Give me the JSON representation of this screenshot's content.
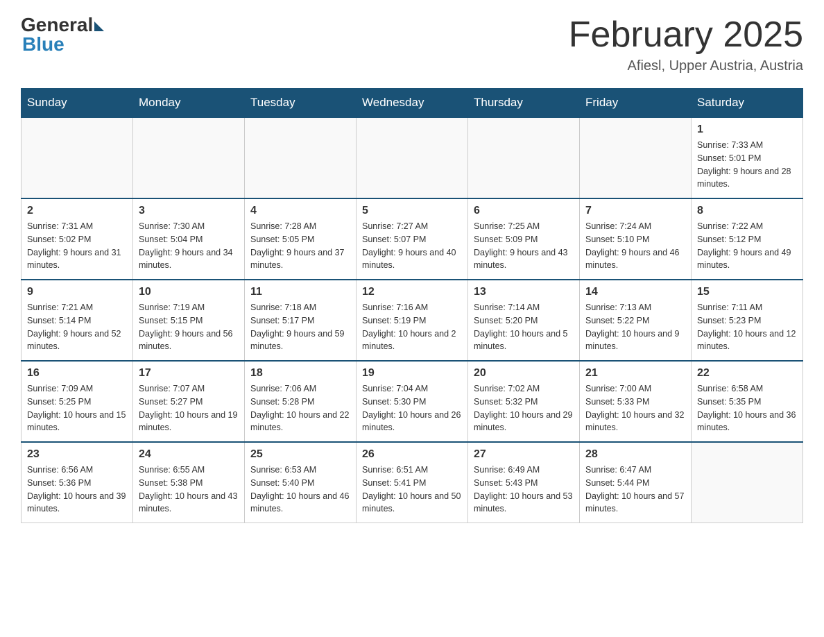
{
  "logo": {
    "general": "General",
    "blue": "Blue"
  },
  "header": {
    "month": "February 2025",
    "location": "Afiesl, Upper Austria, Austria"
  },
  "days_of_week": [
    "Sunday",
    "Monday",
    "Tuesday",
    "Wednesday",
    "Thursday",
    "Friday",
    "Saturday"
  ],
  "weeks": [
    [
      {
        "day": "",
        "info": ""
      },
      {
        "day": "",
        "info": ""
      },
      {
        "day": "",
        "info": ""
      },
      {
        "day": "",
        "info": ""
      },
      {
        "day": "",
        "info": ""
      },
      {
        "day": "",
        "info": ""
      },
      {
        "day": "1",
        "info": "Sunrise: 7:33 AM\nSunset: 5:01 PM\nDaylight: 9 hours and 28 minutes."
      }
    ],
    [
      {
        "day": "2",
        "info": "Sunrise: 7:31 AM\nSunset: 5:02 PM\nDaylight: 9 hours and 31 minutes."
      },
      {
        "day": "3",
        "info": "Sunrise: 7:30 AM\nSunset: 5:04 PM\nDaylight: 9 hours and 34 minutes."
      },
      {
        "day": "4",
        "info": "Sunrise: 7:28 AM\nSunset: 5:05 PM\nDaylight: 9 hours and 37 minutes."
      },
      {
        "day": "5",
        "info": "Sunrise: 7:27 AM\nSunset: 5:07 PM\nDaylight: 9 hours and 40 minutes."
      },
      {
        "day": "6",
        "info": "Sunrise: 7:25 AM\nSunset: 5:09 PM\nDaylight: 9 hours and 43 minutes."
      },
      {
        "day": "7",
        "info": "Sunrise: 7:24 AM\nSunset: 5:10 PM\nDaylight: 9 hours and 46 minutes."
      },
      {
        "day": "8",
        "info": "Sunrise: 7:22 AM\nSunset: 5:12 PM\nDaylight: 9 hours and 49 minutes."
      }
    ],
    [
      {
        "day": "9",
        "info": "Sunrise: 7:21 AM\nSunset: 5:14 PM\nDaylight: 9 hours and 52 minutes."
      },
      {
        "day": "10",
        "info": "Sunrise: 7:19 AM\nSunset: 5:15 PM\nDaylight: 9 hours and 56 minutes."
      },
      {
        "day": "11",
        "info": "Sunrise: 7:18 AM\nSunset: 5:17 PM\nDaylight: 9 hours and 59 minutes."
      },
      {
        "day": "12",
        "info": "Sunrise: 7:16 AM\nSunset: 5:19 PM\nDaylight: 10 hours and 2 minutes."
      },
      {
        "day": "13",
        "info": "Sunrise: 7:14 AM\nSunset: 5:20 PM\nDaylight: 10 hours and 5 minutes."
      },
      {
        "day": "14",
        "info": "Sunrise: 7:13 AM\nSunset: 5:22 PM\nDaylight: 10 hours and 9 minutes."
      },
      {
        "day": "15",
        "info": "Sunrise: 7:11 AM\nSunset: 5:23 PM\nDaylight: 10 hours and 12 minutes."
      }
    ],
    [
      {
        "day": "16",
        "info": "Sunrise: 7:09 AM\nSunset: 5:25 PM\nDaylight: 10 hours and 15 minutes."
      },
      {
        "day": "17",
        "info": "Sunrise: 7:07 AM\nSunset: 5:27 PM\nDaylight: 10 hours and 19 minutes."
      },
      {
        "day": "18",
        "info": "Sunrise: 7:06 AM\nSunset: 5:28 PM\nDaylight: 10 hours and 22 minutes."
      },
      {
        "day": "19",
        "info": "Sunrise: 7:04 AM\nSunset: 5:30 PM\nDaylight: 10 hours and 26 minutes."
      },
      {
        "day": "20",
        "info": "Sunrise: 7:02 AM\nSunset: 5:32 PM\nDaylight: 10 hours and 29 minutes."
      },
      {
        "day": "21",
        "info": "Sunrise: 7:00 AM\nSunset: 5:33 PM\nDaylight: 10 hours and 32 minutes."
      },
      {
        "day": "22",
        "info": "Sunrise: 6:58 AM\nSunset: 5:35 PM\nDaylight: 10 hours and 36 minutes."
      }
    ],
    [
      {
        "day": "23",
        "info": "Sunrise: 6:56 AM\nSunset: 5:36 PM\nDaylight: 10 hours and 39 minutes."
      },
      {
        "day": "24",
        "info": "Sunrise: 6:55 AM\nSunset: 5:38 PM\nDaylight: 10 hours and 43 minutes."
      },
      {
        "day": "25",
        "info": "Sunrise: 6:53 AM\nSunset: 5:40 PM\nDaylight: 10 hours and 46 minutes."
      },
      {
        "day": "26",
        "info": "Sunrise: 6:51 AM\nSunset: 5:41 PM\nDaylight: 10 hours and 50 minutes."
      },
      {
        "day": "27",
        "info": "Sunrise: 6:49 AM\nSunset: 5:43 PM\nDaylight: 10 hours and 53 minutes."
      },
      {
        "day": "28",
        "info": "Sunrise: 6:47 AM\nSunset: 5:44 PM\nDaylight: 10 hours and 57 minutes."
      },
      {
        "day": "",
        "info": ""
      }
    ]
  ]
}
